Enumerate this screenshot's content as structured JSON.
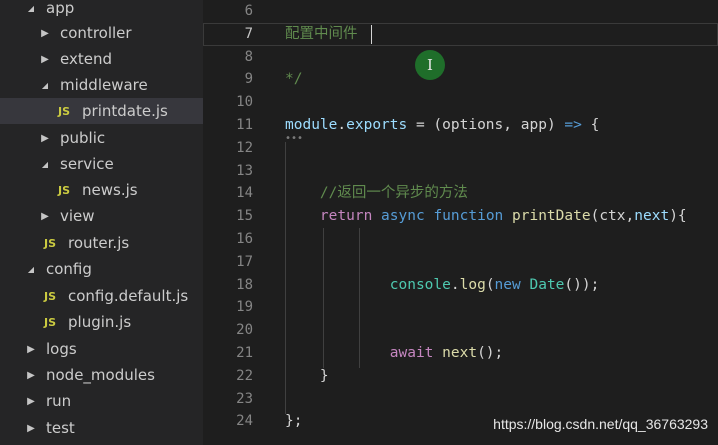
{
  "explorer": {
    "items": [
      {
        "label": "app",
        "kind": "folder-open",
        "indent": 0
      },
      {
        "label": "controller",
        "kind": "folder-closed",
        "indent": 1
      },
      {
        "label": "extend",
        "kind": "folder-closed",
        "indent": 1
      },
      {
        "label": "middleware",
        "kind": "folder-open",
        "indent": 1
      },
      {
        "label": "printdate.js",
        "kind": "js-file",
        "indent": 2,
        "selected": true
      },
      {
        "label": "public",
        "kind": "folder-closed",
        "indent": 1
      },
      {
        "label": "service",
        "kind": "folder-open",
        "indent": 1
      },
      {
        "label": "news.js",
        "kind": "js-file",
        "indent": 2
      },
      {
        "label": "view",
        "kind": "folder-closed",
        "indent": 1
      },
      {
        "label": "router.js",
        "kind": "js-file",
        "indent": 1
      },
      {
        "label": "config",
        "kind": "folder-open",
        "indent": 0
      },
      {
        "label": "config.default.js",
        "kind": "js-file",
        "indent": 1
      },
      {
        "label": "plugin.js",
        "kind": "js-file",
        "indent": 1
      },
      {
        "label": "logs",
        "kind": "folder-closed",
        "indent": 0
      },
      {
        "label": "node_modules",
        "kind": "folder-closed",
        "indent": 0
      },
      {
        "label": "run",
        "kind": "folder-closed",
        "indent": 0
      },
      {
        "label": "test",
        "kind": "folder-closed",
        "indent": 0
      }
    ],
    "js_badge": "JS",
    "chevron_open": "◢",
    "chevron_closed": "▶"
  },
  "editor": {
    "lines": [
      {
        "n": "6",
        "tokens": []
      },
      {
        "n": "7",
        "current": true,
        "tokens": [
          {
            "t": "配置中间件",
            "c": "cm"
          }
        ]
      },
      {
        "n": "8",
        "tokens": []
      },
      {
        "n": "9",
        "tokens": [
          {
            "t": "*/",
            "c": "cm"
          }
        ]
      },
      {
        "n": "10",
        "tokens": []
      },
      {
        "n": "11",
        "tokens": [
          {
            "t": "module",
            "c": "id"
          },
          {
            "t": ".",
            "c": "plain"
          },
          {
            "t": "exports",
            "c": "id"
          },
          {
            "t": " = (",
            "c": "plain"
          },
          {
            "t": "options",
            "c": "plain"
          },
          {
            "t": ", ",
            "c": "plain"
          },
          {
            "t": "app",
            "c": "plain"
          },
          {
            "t": ") ",
            "c": "plain"
          },
          {
            "t": "=>",
            "c": "kw"
          },
          {
            "t": " {",
            "c": "plain"
          }
        ]
      },
      {
        "n": "12",
        "tokens": []
      },
      {
        "n": "13",
        "tokens": []
      },
      {
        "n": "14",
        "tokens": [
          {
            "t": "    //返回一个异步的方法",
            "c": "cm"
          }
        ]
      },
      {
        "n": "15",
        "tokens": [
          {
            "t": "    ",
            "c": "plain"
          },
          {
            "t": "return",
            "c": "ctl"
          },
          {
            "t": " ",
            "c": "plain"
          },
          {
            "t": "async",
            "c": "kw"
          },
          {
            "t": " ",
            "c": "plain"
          },
          {
            "t": "function",
            "c": "kw"
          },
          {
            "t": " ",
            "c": "plain"
          },
          {
            "t": "printDate",
            "c": "fn"
          },
          {
            "t": "(",
            "c": "plain"
          },
          {
            "t": "ctx",
            "c": "plain"
          },
          {
            "t": ",",
            "c": "plain"
          },
          {
            "t": "next",
            "c": "id"
          },
          {
            "t": "){",
            "c": "plain"
          }
        ]
      },
      {
        "n": "16",
        "tokens": []
      },
      {
        "n": "17",
        "tokens": []
      },
      {
        "n": "18",
        "tokens": [
          {
            "t": "            ",
            "c": "plain"
          },
          {
            "t": "console",
            "c": "cls"
          },
          {
            "t": ".",
            "c": "plain"
          },
          {
            "t": "log",
            "c": "fn"
          },
          {
            "t": "(",
            "c": "plain"
          },
          {
            "t": "new",
            "c": "kw"
          },
          {
            "t": " ",
            "c": "plain"
          },
          {
            "t": "Date",
            "c": "cls"
          },
          {
            "t": "());",
            "c": "plain"
          }
        ]
      },
      {
        "n": "19",
        "tokens": []
      },
      {
        "n": "20",
        "tokens": []
      },
      {
        "n": "21",
        "tokens": [
          {
            "t": "            ",
            "c": "plain"
          },
          {
            "t": "await",
            "c": "ctl"
          },
          {
            "t": " ",
            "c": "plain"
          },
          {
            "t": "next",
            "c": "fn"
          },
          {
            "t": "();",
            "c": "plain"
          }
        ]
      },
      {
        "n": "22",
        "tokens": [
          {
            "t": "    }",
            "c": "plain"
          }
        ]
      },
      {
        "n": "23",
        "tokens": []
      },
      {
        "n": "24",
        "tokens": [
          {
            "t": "};",
            "c": "plain"
          }
        ]
      }
    ],
    "fold_marker": "•••"
  },
  "cursor_icon": "text-cursor-icon",
  "cursor_glyph": "I",
  "watermark": "https://blog.csdn.net/qq_36763293",
  "colors": {
    "comment": "#608b4e",
    "keyword": "#569cd6",
    "control": "#c586c0",
    "function": "#dcdcaa",
    "variable": "#9cdcfe",
    "class": "#4ec9b0",
    "js_icon": "#cbcb41"
  }
}
